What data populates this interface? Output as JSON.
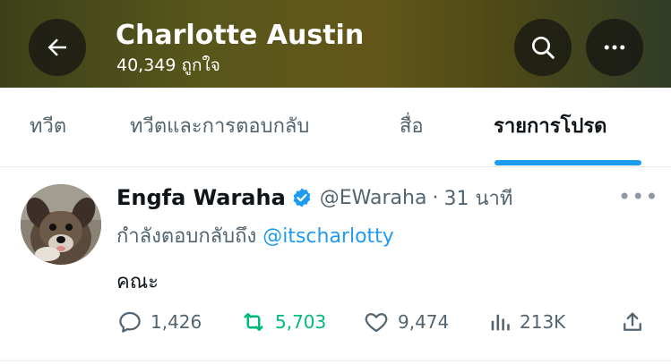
{
  "header": {
    "title": "Charlotte Austin",
    "subtitle": "40,349 ถูกใจ",
    "back_icon": "arrow-left-icon",
    "search_icon": "search-icon",
    "more_icon": "more-horizontal-icon"
  },
  "tabs": [
    {
      "label": "ทวีต",
      "active": false
    },
    {
      "label": "ทวีตและการตอบกลับ",
      "active": false
    },
    {
      "label": "สื่อ",
      "active": false
    },
    {
      "label": "รายการโปรด",
      "active": true
    }
  ],
  "tweet": {
    "author_name": "Engfa Waraha",
    "handle": "@EWaraha",
    "separator": "·",
    "time": "31 นาที",
    "replying_prefix": "กำลังตอบกลับถึง",
    "replying_to": "@itscharlotty",
    "text": "คณะ",
    "stats": {
      "replies": "1,426",
      "retweets": "5,703",
      "likes": "9,474",
      "views": "213K"
    }
  },
  "colors": {
    "accent": "#1d9bf0",
    "retweet_active": "#00ba7c",
    "muted_text": "#536471"
  }
}
